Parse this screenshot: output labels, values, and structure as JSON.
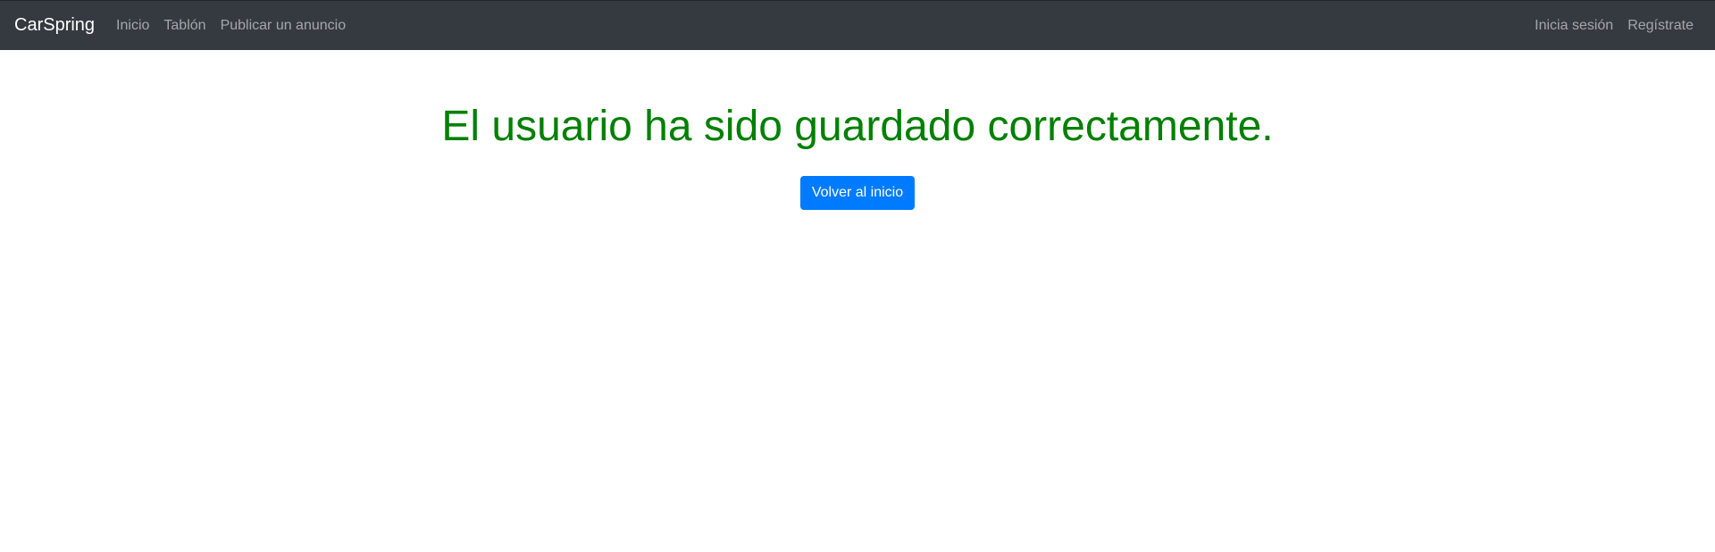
{
  "navbar": {
    "brand": "CarSpring",
    "left_links": [
      "Inicio",
      "Tablón",
      "Publicar un anuncio"
    ],
    "right_links": [
      "Inicia sesión",
      "Regístrate"
    ]
  },
  "main": {
    "message": "El usuario ha sido guardado correctamente.",
    "button_label": "Volver al inicio"
  },
  "colors": {
    "navbar_bg": "#343a40",
    "message": "#008000",
    "button_bg": "#007bff"
  }
}
